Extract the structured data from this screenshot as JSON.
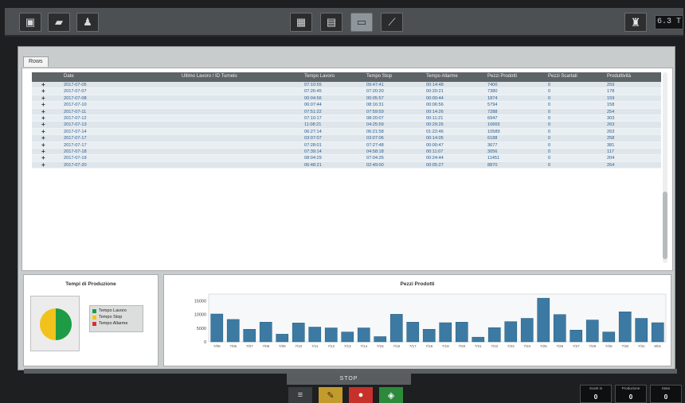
{
  "toolbar": {
    "left_icons": [
      "monitor-icon",
      "car-icon",
      "user-icon"
    ],
    "center_icons": [
      "grid-icon",
      "list-icon",
      "card-icon",
      "wrench-icon"
    ],
    "right_icon": "machine-icon",
    "badge": "6.3 T"
  },
  "tab": {
    "label": "Rows"
  },
  "table": {
    "columns": [
      "Date",
      "Ultimo Lavoro / ID Turnelo",
      "Tempo Lavoro",
      "Tempo Stop",
      "Tempo Allarme",
      "Pezzi Prodotti",
      "Pezzi Scartati",
      "Produttività"
    ],
    "rows": [
      [
        "2017-07-05",
        "",
        "07:10:55",
        "09:47:41",
        "00:14:48",
        "7400",
        "0",
        "259"
      ],
      [
        "2017-07-07",
        "",
        "07:26:45",
        "07:20:20",
        "00:20:21",
        "7380",
        "0",
        "178"
      ],
      [
        "2017-07-08",
        "",
        "00:04:56",
        "00:05:57",
        "00:00:44",
        "1874",
        "0",
        "159"
      ],
      [
        "2017-07-10",
        "",
        "06:07:44",
        "08:16:31",
        "00:06:56",
        "5794",
        "0",
        "158"
      ],
      [
        "2017-07-11",
        "",
        "07:51:22",
        "07:59:59",
        "00:14:26",
        "7288",
        "0",
        "254"
      ],
      [
        "2017-07-12",
        "",
        "07:10:17",
        "08:20:07",
        "00:11:21",
        "6947",
        "0",
        "303"
      ],
      [
        "2017-07-13",
        "",
        "11:08:21",
        "04:25:59",
        "00:29:26",
        "10665",
        "0",
        "263"
      ],
      [
        "2017-07-14",
        "",
        "06:27:14",
        "06:21:58",
        "01:22:46",
        "10589",
        "0",
        "263"
      ],
      [
        "2017-07-17",
        "",
        "03:07:07",
        "03:07:06",
        "00:14:05",
        "6188",
        "0",
        "258"
      ],
      [
        "2017-07-17",
        "",
        "07:28:01",
        "07:27:48",
        "00:00:47",
        "3677",
        "0",
        "381"
      ],
      [
        "2017-07-18",
        "",
        "07:39:14",
        "04:58:18",
        "00:11:07",
        "3056",
        "0",
        "117"
      ],
      [
        "2017-07-19",
        "",
        "08:04:29",
        "07:04:26",
        "00:24:44",
        "11451",
        "0",
        "204"
      ],
      [
        "2017-07-20",
        "",
        "06:48:21",
        "02:49:00",
        "00:05:27",
        "8870",
        "0",
        "264"
      ]
    ]
  },
  "pie_card": {
    "title": "Tempi di Produzione",
    "legend": [
      "Tempo Lavoro",
      "Tempo Stop",
      "Tempo Allarme"
    ]
  },
  "chart_data": {
    "type": "bar",
    "title": "Pezzi Prodotti",
    "yticks": [
      "15000",
      "10000",
      "5000",
      "0"
    ],
    "ylim": [
      0,
      17500
    ],
    "categories": [
      "7/05",
      "7/06",
      "7/07",
      "7/08",
      "7/09",
      "7/10",
      "7/11",
      "7/12",
      "7/13",
      "7/14",
      "7/15",
      "7/16",
      "7/17",
      "7/18",
      "7/19",
      "7/20",
      "7/21",
      "7/22",
      "7/23",
      "7/24",
      "7/25",
      "7/26",
      "7/27",
      "7/28",
      "7/29",
      "7/30",
      "7/31",
      "8/01"
    ],
    "values": [
      10200,
      8200,
      4600,
      7200,
      2800,
      6900,
      5400,
      5100,
      3600,
      5100,
      1900,
      10100,
      7200,
      4600,
      7000,
      7200,
      1700,
      5200,
      7400,
      8600,
      16000,
      10000,
      4300,
      8000,
      3600,
      11000,
      8600,
      7000
    ],
    "bar_color": "#3c7aa3",
    "grid": false
  },
  "footer": {
    "stop_label": "STOP",
    "buttons": [
      "list-icon",
      "pencil-icon",
      "stop-circle-icon",
      "start-circle-icon"
    ],
    "stats": [
      {
        "label": "Scarti in",
        "value": "0"
      },
      {
        "label": "Produzione",
        "value": "0"
      },
      {
        "label": "Stato",
        "value": "0"
      }
    ]
  }
}
